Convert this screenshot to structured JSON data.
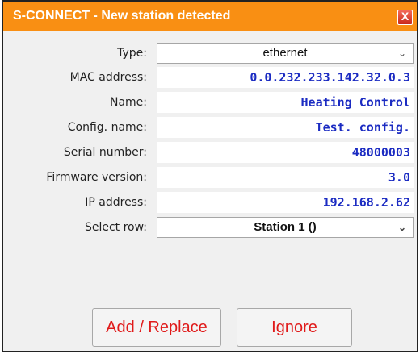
{
  "window": {
    "title": "S-CONNECT - New station detected",
    "close_glyph": "X"
  },
  "fields": [
    {
      "label": "Type:",
      "value": "ethernet",
      "kind": "select"
    },
    {
      "label": "MAC address:",
      "value": "0.0.232.233.142.32.0.3",
      "kind": "text"
    },
    {
      "label": "Name:",
      "value": "Heating Control",
      "kind": "text"
    },
    {
      "label": "Config. name:",
      "value": "Test. config.",
      "kind": "text"
    },
    {
      "label": "Serial number:",
      "value": "48000003",
      "kind": "text"
    },
    {
      "label": "Firmware version:",
      "value": "3.0",
      "kind": "text"
    },
    {
      "label": "IP address:",
      "value": "192.168.2.62",
      "kind": "text"
    },
    {
      "label": "Select row:",
      "value": "Station 1 ()",
      "kind": "select"
    }
  ],
  "buttons": {
    "add_replace": "Add / Replace",
    "ignore": "Ignore"
  },
  "colors": {
    "titlebar": "#f98f13",
    "value_text": "#1b2bc2",
    "button_text": "#e01a1a"
  },
  "icons": {
    "close": "close-icon",
    "dropdown": "chevron-down-icon"
  }
}
